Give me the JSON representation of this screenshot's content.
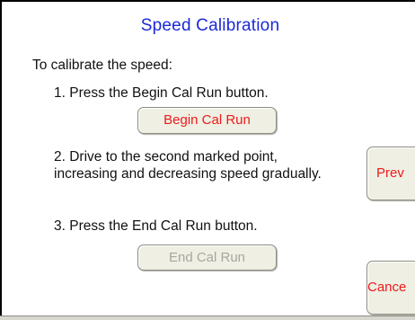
{
  "screen": {
    "title": "Speed Calibration",
    "intro": "To calibrate the speed:",
    "steps": [
      "1. Press the Begin Cal Run button.",
      "2. Drive to the second marked point, increasing and decreasing speed gradually.",
      "3. Press the End Cal Run button."
    ]
  },
  "buttons": {
    "begin_cal_run": "Begin Cal Run",
    "end_cal_run": "End Cal Run",
    "prev": "Prev",
    "cancel": "Cance"
  },
  "colors": {
    "title": "#1a2ad8",
    "button_text_active": "#ee1a1a",
    "button_text_disabled": "#a7a7a0",
    "button_face": "#efefe4"
  }
}
